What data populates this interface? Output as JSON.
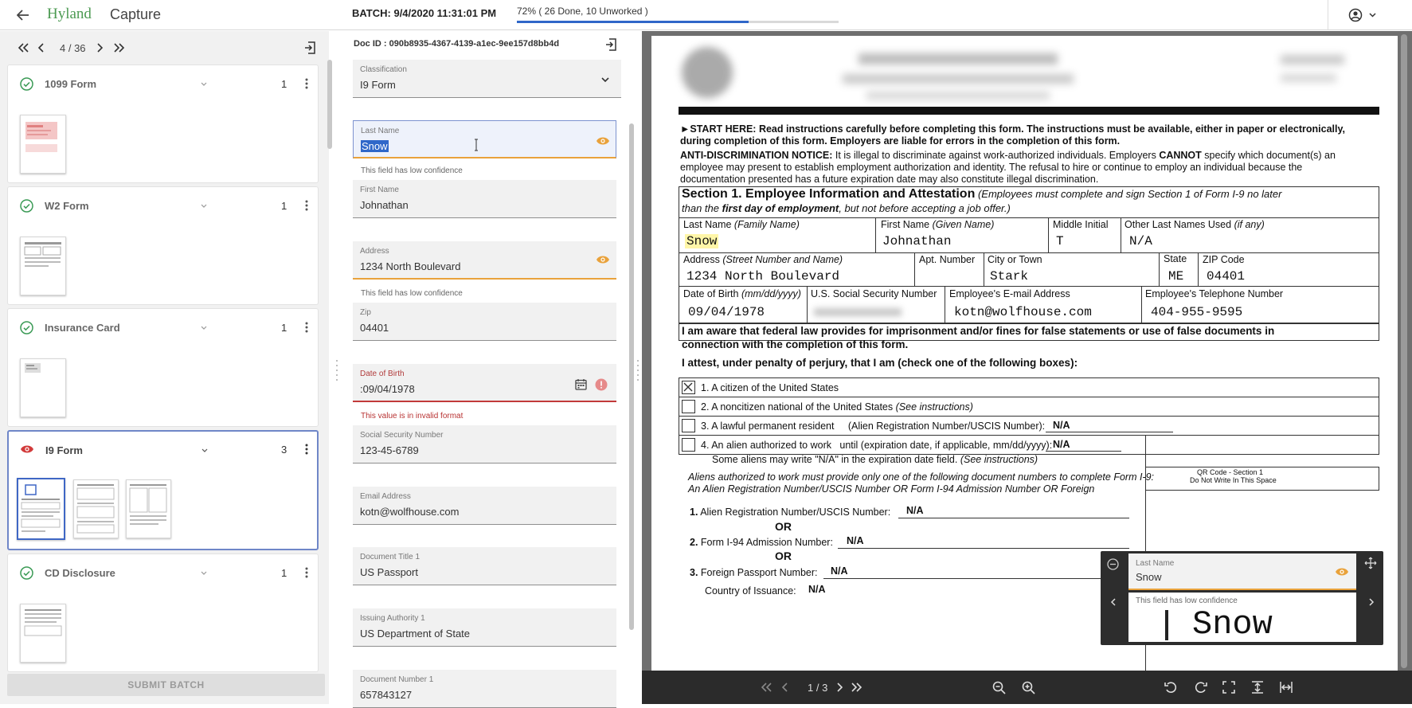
{
  "topbar": {
    "brand": "Hyland",
    "product": "Capture",
    "batch_label": "BATCH: 9/4/2020 11:31:01 PM",
    "progress_text": "72% ( 26 Done, 10 Unworked )",
    "progress_fraction": 0.72
  },
  "navigator": {
    "position": "4 / 36"
  },
  "documents": [
    {
      "title": "1099 Form",
      "count": "1",
      "status": "check"
    },
    {
      "title": "W2 Form",
      "count": "1",
      "status": "check"
    },
    {
      "title": "Insurance Card",
      "count": "1",
      "status": "check"
    },
    {
      "title": "I9 Form",
      "count": "3",
      "status": "eye"
    },
    {
      "title": "CD Disclosure",
      "count": "1",
      "status": "check"
    }
  ],
  "submit_label": "SUBMIT BATCH",
  "form": {
    "doc_id": "Doc ID : 090b8935-4367-4139-a1ec-9ee157d8bb4d",
    "classification_label": "Classification",
    "classification_value": "I9 Form",
    "fields": [
      {
        "label": "Last Name",
        "value": "Snow",
        "hint": "This field has low confidence"
      },
      {
        "label": "First Name",
        "value": "Johnathan"
      },
      {
        "label": "Address",
        "value": "1234 North Boulevard",
        "hint": "This field has low confidence"
      },
      {
        "label": "Zip",
        "value": "04401"
      },
      {
        "label": "Date of Birth",
        "value": ":09/04/1978",
        "hint": "This value is in invalid format"
      },
      {
        "label": "Social Security Number",
        "value": "123-45-6789"
      },
      {
        "label": "Email Address",
        "value": "kotn@wolfhouse.com"
      },
      {
        "label": "Document Title 1",
        "value": "US Passport"
      },
      {
        "label": "Issuing Authority 1",
        "value": "US Department of State"
      },
      {
        "label": "Document Number 1",
        "value": "657843127"
      }
    ]
  },
  "viewer": {
    "page_indicator": "1 / 3",
    "doc": {
      "start_here": "►START HERE: Read instructions carefully before completing this form. The instructions must be available, either in paper or electronically,",
      "start_here2": "during completion of this form. Employers are liable for errors in the completion of this form.",
      "anti_bold": "ANTI-DISCRIMINATION NOTICE:",
      "anti_1": " It is illegal to discriminate against work-authorized individuals. Employers ",
      "anti_cannot": "CANNOT",
      "anti_2": " specify which document(s) an",
      "anti_3": "employee may present to establish employment authorization and identity. The refusal to hire or continue to employ an individual because the",
      "anti_4": "documentation presented has a future expiration date may also constitute illegal discrimination.",
      "section_title": "Section 1. Employee Information and Attestation",
      "section_sub": " (Employees must complete and sign Section 1 of Form I-9 no later",
      "section_sub2a": "than the ",
      "section_sub2b": "first day of employment",
      "section_sub2c": ", but not before accepting a job offer.)",
      "lbl_last": "Last Name ",
      "lbl_last_i": "(Family Name)",
      "lbl_first": "First Name ",
      "lbl_first_i": "(Given Name)",
      "lbl_mi": "Middle Initial",
      "lbl_other": "Other Last Names Used ",
      "lbl_other_i": "(if any)",
      "v_last": "Snow",
      "v_first": "Johnathan",
      "v_mi": "T",
      "v_other": "N/A",
      "lbl_addr": "Address ",
      "lbl_addr_i": "(Street Number and Name)",
      "lbl_apt": "Apt. Number",
      "lbl_city": "City or Town",
      "lbl_state": "State",
      "lbl_zip": "ZIP Code",
      "v_addr": "1234 North Boulevard",
      "v_city": "Stark",
      "v_state": "ME",
      "v_zip": "04401",
      "lbl_dob": "Date of Birth ",
      "lbl_dob_i": "(mm/dd/yyyy)",
      "lbl_ssn": "U.S. Social Security Number",
      "lbl_email": "Employee's E-mail Address",
      "lbl_phone": "Employee's Telephone Number",
      "v_dob": "09/04/1978",
      "v_email": "kotn@wolfhouse.com",
      "v_phone": "404-955-9595",
      "aware1": "I am aware that federal law provides for imprisonment and/or fines for false statements or use of false documents in",
      "aware2": "connection with the completion of this form.",
      "attest": "I attest, under penalty of perjury, that I am (check one of the following boxes):",
      "opt1": "1. A citizen of the United States",
      "opt2a": "2. A noncitizen national of the United States ",
      "opt2b": "(See instructions)",
      "opt3": "3. A lawful permanent resident     (Alien Registration Number/USCIS Number):",
      "opt3v": "N/A",
      "opt4": "4. An alien authorized to work   until (expiration date, if applicable, mm/dd/yyyy):",
      "opt4v": "N/A",
      "opt4b": "Some aliens may write \"N/A\" in the expiration date field. ",
      "opt4c": "(See instructions)",
      "aliens1": "Aliens authorized to work must provide only one of the following document numbers to complete Form I-9:",
      "aliens2": "An Alien Registration Number/USCIS Number OR Form I-94 Admission Number OR Foreign",
      "qr1": "QR Code - Section 1",
      "qr2": "Do Not Write In This Space",
      "n1": "1.",
      "n1t": " Alien Registration Number/USCIS Number:",
      "n1v": "N/A",
      "or": "OR",
      "n2": "2.",
      "n2t": " Form I-94 Admission Number:",
      "n2v": "N/A",
      "n3": "3.",
      "n3t": " Foreign Passport Number:",
      "n3v": "N/A",
      "country": "Country of Issuance:",
      "countryv": "N/A"
    },
    "popup": {
      "label": "Last Name",
      "value": "Snow",
      "hint": "This field has low confidence",
      "snippet": "Snow"
    }
  }
}
